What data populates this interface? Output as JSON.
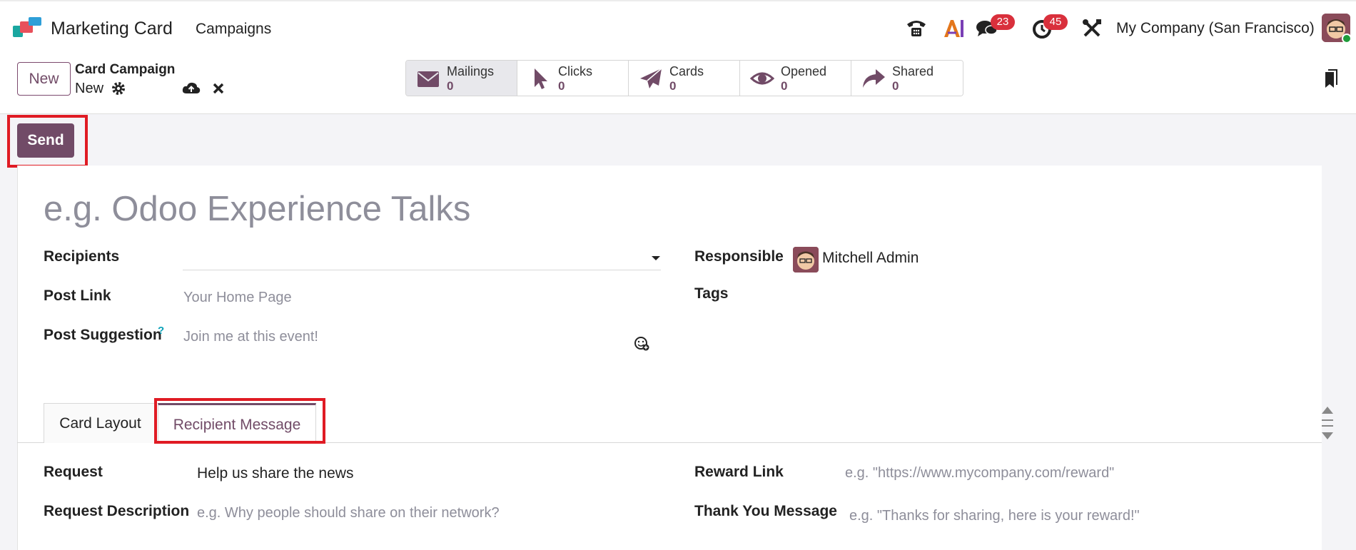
{
  "navbar": {
    "app_name": "Marketing Card",
    "menu_campaigns": "Campaigns",
    "messages_badge": "23",
    "activities_badge": "45",
    "company": "My Company (San Francisco)"
  },
  "control": {
    "new_button": "New",
    "breadcrumb_title": "Card Campaign",
    "breadcrumb_record": "New",
    "stats": [
      {
        "label": "Mailings",
        "value": "0",
        "icon": "envelope-icon"
      },
      {
        "label": "Clicks",
        "value": "0",
        "icon": "cursor-icon"
      },
      {
        "label": "Cards",
        "value": "0",
        "icon": "paper-plane-icon"
      },
      {
        "label": "Opened",
        "value": "0",
        "icon": "eye-icon"
      },
      {
        "label": "Shared",
        "value": "0",
        "icon": "share-icon"
      }
    ]
  },
  "statusbar": {
    "send_button": "Send"
  },
  "form": {
    "name_placeholder": "e.g. Odoo Experience Talks",
    "recipients_label": "Recipients",
    "post_link_label": "Post Link",
    "post_link_placeholder": "Your Home Page",
    "post_suggestion_label": "Post Suggestion",
    "post_suggestion_help": "?",
    "post_suggestion_placeholder": "Join me at this event!",
    "responsible_label": "Responsible",
    "responsible_value": "Mitchell Admin",
    "tags_label": "Tags"
  },
  "tabs": [
    "Card Layout",
    "Recipient Message"
  ],
  "recipient_message": {
    "request_label": "Request",
    "request_value": "Help us share the news",
    "request_desc_label": "Request Description",
    "request_desc_placeholder": "e.g. Why people should share on their network?",
    "reward_link_label": "Reward Link",
    "reward_link_placeholder": "e.g. \"https://www.mycompany.com/reward\"",
    "thank_you_label": "Thank You Message",
    "thank_you_placeholder": "e.g. \"Thanks for sharing, here is your reward!\""
  },
  "colors": {
    "brand": "#714b67",
    "badge": "#d9303c",
    "highlight": "#e01b24"
  }
}
